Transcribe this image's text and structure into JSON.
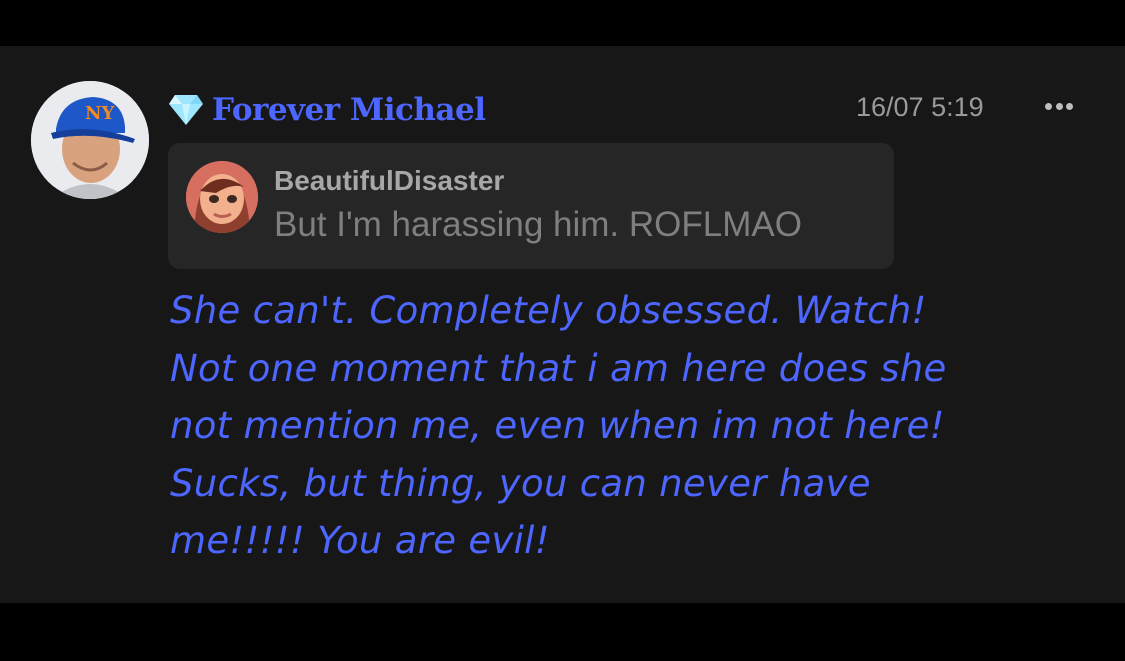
{
  "post": {
    "author_name": "Forever Michael",
    "badge_icon": "diamond-icon",
    "timestamp": "16/07 5:19",
    "more_icon": "more-icon",
    "quote": {
      "author": "BeautifulDisaster",
      "text": "But I'm harassing him. ROFLMAO"
    },
    "lines": [
      "She can't. Completely obsessed. Watch!",
      "Not one moment that i am here does she",
      "not mention me, even when im not here!",
      "Sucks, but thing, you can never have",
      "me!!!!! You are evil!"
    ]
  },
  "colors": {
    "accent": "#4d66ff",
    "background": "#171717",
    "quote_background": "#262626"
  }
}
